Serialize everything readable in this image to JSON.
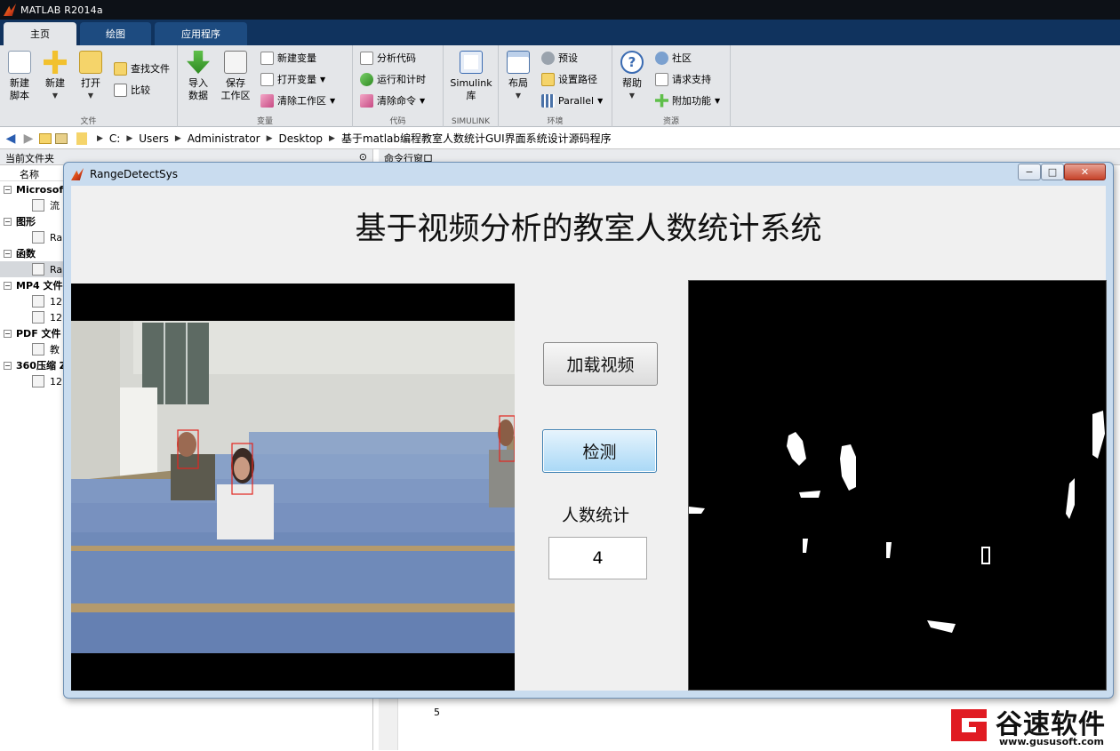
{
  "app": {
    "title": "MATLAB R2014a"
  },
  "tabs": [
    {
      "label": "主页",
      "active": true
    },
    {
      "label": "绘图",
      "active": false
    },
    {
      "label": "应用程序",
      "active": false
    }
  ],
  "ribbon": {
    "file": {
      "caption": "文件",
      "new_script": "新建\n脚本",
      "new": "新建",
      "open": "打开",
      "find_files": "查找文件",
      "compare": "比较"
    },
    "variable": {
      "caption": "变量",
      "import_data": "导入\n数据",
      "save_workspace": "保存\n工作区",
      "new_variable": "新建变量",
      "open_variable": "打开变量",
      "clear_workspace": "清除工作区"
    },
    "code": {
      "caption": "代码",
      "analyze_code": "分析代码",
      "run_and_time": "运行和计时",
      "clear_commands": "清除命令"
    },
    "simulink": {
      "caption": "SIMULINK",
      "library": "Simulink\n库"
    },
    "environment": {
      "caption": "环境",
      "layout": "布局",
      "preferences": "预设",
      "set_path": "设置路径",
      "parallel": "Parallel"
    },
    "resources": {
      "caption": "资源",
      "help": "帮助",
      "community": "社区",
      "request_support": "请求支持",
      "add_ons": "附加功能"
    }
  },
  "address": {
    "crumbs": [
      "C:",
      "Users",
      "Administrator",
      "Desktop",
      "基于matlab编程教室人数统计GUI界面系统设计源码程序"
    ]
  },
  "folder_panel": {
    "title": "当前文件夹",
    "column": "名称",
    "groups": [
      {
        "label": "Microsof",
        "toggle": "−",
        "items": [
          {
            "label": "流",
            "selected": false
          }
        ]
      },
      {
        "label": "图形",
        "toggle": "−",
        "items": [
          {
            "label": "Ra",
            "selected": false
          }
        ]
      },
      {
        "label": "函数",
        "toggle": "−",
        "items": [
          {
            "label": "Ra",
            "selected": true
          }
        ]
      },
      {
        "label": "MP4 文件",
        "toggle": "−",
        "items": [
          {
            "label": "12",
            "selected": false
          },
          {
            "label": "12",
            "selected": false
          }
        ]
      },
      {
        "label": "PDF 文件",
        "toggle": "−",
        "items": [
          {
            "label": "教",
            "selected": false
          }
        ]
      },
      {
        "label": "360压缩 Z",
        "toggle": "−",
        "items": [
          {
            "label": "12",
            "selected": false
          }
        ]
      }
    ]
  },
  "command_window": {
    "title": "命令行窗口",
    "line_number": "5"
  },
  "gui": {
    "window_title": "RangeDetectSys",
    "heading": "基于视频分析的教室人数统计系统",
    "load_button": "加载视频",
    "detect_button": "检测",
    "count_label": "人数统计",
    "count_value": "4"
  },
  "watermark": {
    "name": "谷速软件",
    "url": "www.gususoft.com"
  },
  "colors": {
    "titlebar": "#0d1117",
    "tabbar": "#10335e",
    "ribbon": "#e4e6e9",
    "gui_bg": "#f0f0f0",
    "detect_box": "#e3261f",
    "brand_red": "#e01b22"
  }
}
